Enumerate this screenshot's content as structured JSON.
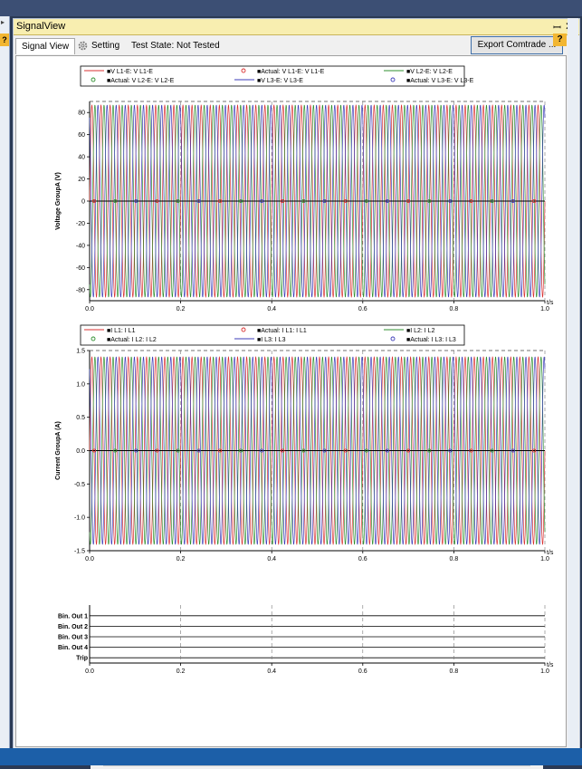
{
  "window": {
    "title": "SignalView",
    "pin_glyph": "ꟷ",
    "close_glyph": "✕",
    "left_help": "?"
  },
  "tabs": {
    "signal_view": "Signal View",
    "setting": "Setting"
  },
  "test_state": "Test State: Not Tested",
  "export_button": "Export Comtrade ...",
  "help_badge": "?",
  "scroll": {
    "left": "<",
    "right": ">"
  },
  "colors": {
    "l1": "#d93030",
    "l2": "#2f8f2f",
    "l3": "#3d3db8",
    "grid": "#bfbfbf",
    "title_bar": "#f8eeb0",
    "help": "#f2b632"
  },
  "chart_data": [
    {
      "type": "line",
      "ylabel": "Voltage GroupA (V)",
      "xlabel": "t/s",
      "xlim": [
        0,
        1.0
      ],
      "ylim": [
        -90,
        90
      ],
      "x_ticks": [
        "0.0",
        "0.2",
        "0.4",
        "0.6",
        "0.8",
        "1.0"
      ],
      "y_ticks": [
        "80",
        "60",
        "40",
        "20",
        "0",
        "-20",
        "-40",
        "-60",
        "-80"
      ],
      "y_tick_values": [
        80,
        60,
        40,
        20,
        0,
        -20,
        -40,
        -60,
        -80
      ],
      "frequency_hz": 50,
      "amplitude": 87,
      "legend": [
        "■V L1-E: V L1-E",
        "■Actual: V L1-E: V L1-E",
        "■V L2-E: V L2-E",
        "■Actual: V L2-E: V L2-E",
        "■V L3-E: V L3-E",
        "■Actual: V L3-E: V L3-E"
      ],
      "series": [
        {
          "name": "■V L1-E: V L1-E",
          "phase_deg": 0,
          "color": "#d93030"
        },
        {
          "name": "■V L2-E: V L2-E",
          "phase_deg": -120,
          "color": "#2f8f2f"
        },
        {
          "name": "■V L3-E: V L3-E",
          "phase_deg": 120,
          "color": "#3d3db8"
        }
      ],
      "actual_series": [
        {
          "name": "■Actual: V L1-E: V L1-E",
          "values": 0
        },
        {
          "name": "■Actual: V L2-E: V L2-E",
          "values": 0
        },
        {
          "name": "■Actual: V L3-E: V L3-E",
          "values": 0
        }
      ]
    },
    {
      "type": "line",
      "ylabel": "Current GroupA (A)",
      "xlabel": "t/s",
      "xlim": [
        0,
        1.0
      ],
      "ylim": [
        -1.5,
        1.5
      ],
      "x_ticks": [
        "0.0",
        "0.2",
        "0.4",
        "0.6",
        "0.8",
        "1.0"
      ],
      "y_ticks": [
        "1.5",
        "1.0",
        "0.5",
        "0.0",
        "-0.5",
        "-1.0",
        "-1.5"
      ],
      "y_tick_values": [
        1.5,
        1.0,
        0.5,
        0.0,
        -0.5,
        -1.0,
        -1.5
      ],
      "frequency_hz": 50,
      "amplitude": 1.41,
      "legend": [
        "■I L1: I L1",
        "■Actual: I L1: I L1",
        "■I L2: I L2",
        "■Actual: I L2: I L2",
        "■I L3: I L3",
        "■Actual: I L3: I L3"
      ],
      "series": [
        {
          "name": "■I L1: I L1",
          "phase_deg": 0,
          "color": "#d93030"
        },
        {
          "name": "■I L2: I L2",
          "phase_deg": -120,
          "color": "#2f8f2f"
        },
        {
          "name": "■I L3: I L3",
          "phase_deg": 120,
          "color": "#3d3db8"
        }
      ],
      "actual_series": [
        {
          "name": "■Actual: I L1: I L1",
          "values": 0
        },
        {
          "name": "■Actual: I L2: I L2",
          "values": 0
        },
        {
          "name": "■Actual: I L3: I L3",
          "values": 0
        }
      ]
    },
    {
      "type": "line",
      "xlabel": "t/s",
      "xlim": [
        0,
        1.0
      ],
      "x_ticks": [
        "0.0",
        "0.2",
        "0.4",
        "0.6",
        "0.8",
        "1.0"
      ],
      "channels": [
        "Bin. Out 1",
        "Bin. Out 2",
        "Bin. Out 3",
        "Bin. Out 4",
        "Trip"
      ],
      "states": [
        0,
        0,
        0,
        0,
        0
      ]
    }
  ]
}
